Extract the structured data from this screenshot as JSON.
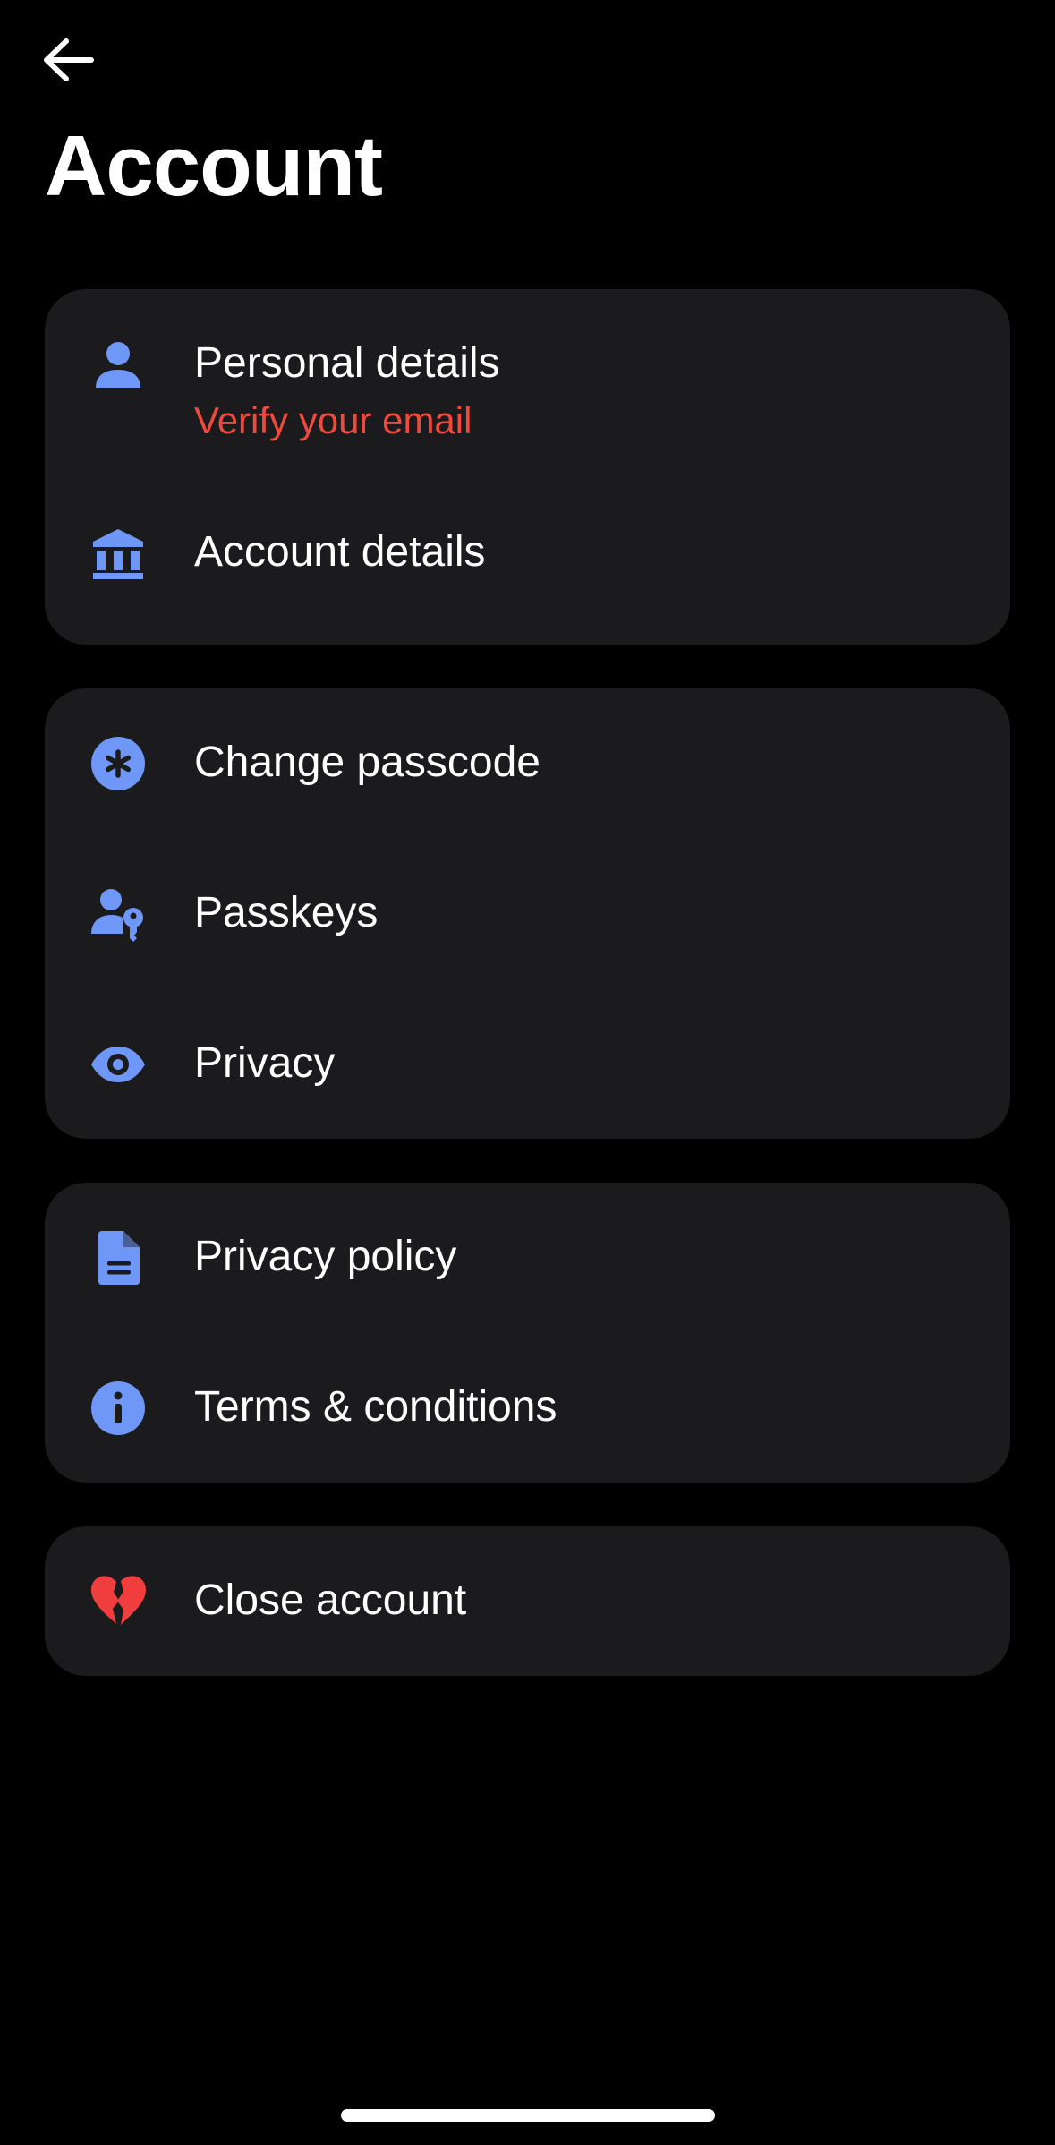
{
  "header": {
    "title": "Account"
  },
  "groups": {
    "profile": {
      "personal_details": {
        "label": "Personal details",
        "sublabel": "Verify your email",
        "icon": "person-icon"
      },
      "account_details": {
        "label": "Account details",
        "icon": "bank-icon"
      }
    },
    "security": {
      "change_passcode": {
        "label": "Change passcode",
        "icon": "asterisk-icon"
      },
      "passkeys": {
        "label": "Passkeys",
        "icon": "person-key-icon"
      },
      "privacy": {
        "label": "Privacy",
        "icon": "eye-icon"
      }
    },
    "legal": {
      "privacy_policy": {
        "label": "Privacy policy",
        "icon": "document-icon"
      },
      "terms": {
        "label": "Terms & conditions",
        "icon": "info-icon"
      }
    },
    "danger": {
      "close_account": {
        "label": "Close account",
        "icon": "broken-heart-icon"
      }
    }
  },
  "colors": {
    "background": "#000000",
    "card": "#1b1b1d",
    "accent_icon": "#6f97f7",
    "warning_text": "#f04a3e",
    "danger_icon": "#f03e3e",
    "text": "#ffffff"
  }
}
